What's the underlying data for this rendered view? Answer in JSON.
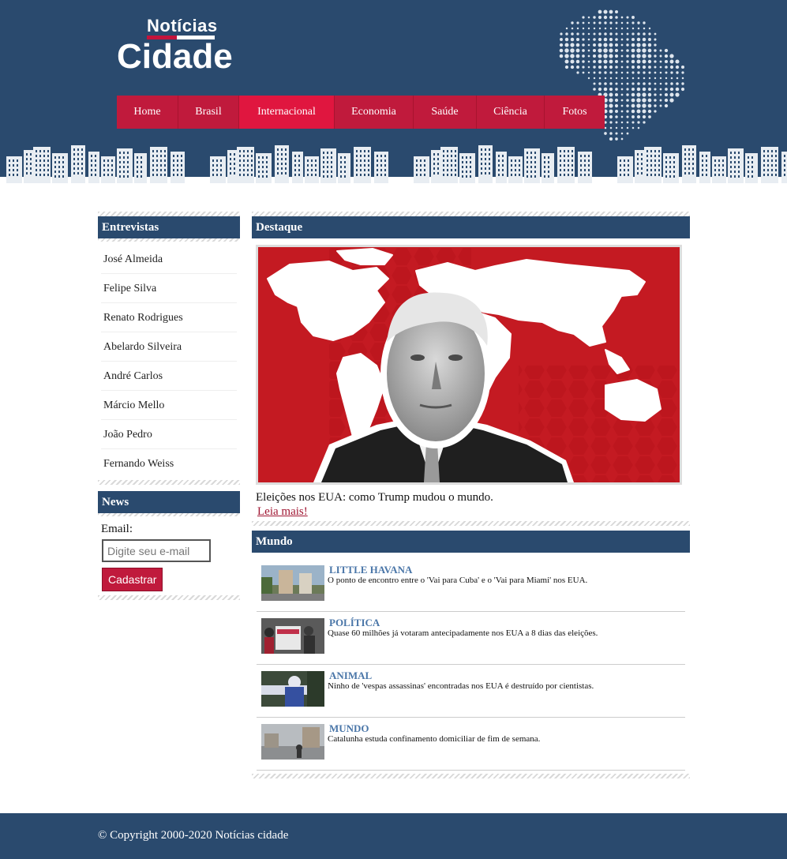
{
  "header": {
    "logo_top": "Notícias",
    "logo_bottom": "Cidade"
  },
  "nav": {
    "items": [
      "Home",
      "Brasil",
      "Internacional",
      "Economia",
      "Saúde",
      "Ciência",
      "Fotos"
    ],
    "active": "Internacional"
  },
  "sidebar": {
    "interviews_title": "Entrevistas",
    "interviews": [
      "José Almeida",
      "Felipe Silva",
      "Renato Rodrigues",
      "Abelardo Silveira",
      "André Carlos",
      "Márcio Mello",
      "João Pedro",
      "Fernando Weiss"
    ],
    "news_title": "News",
    "email_label": "Email:",
    "email_placeholder": "Digite seu e-mail",
    "subscribe_label": "Cadastrar"
  },
  "featured": {
    "title": "Destaque",
    "caption": "Eleições nos EUA: como Trump mudou o mundo.",
    "link": "Leia mais!"
  },
  "world": {
    "title": "Mundo",
    "items": [
      {
        "category": "LITTLE HAVANA",
        "text": "O ponto de encontro entre o 'Vai para Cuba' e o 'Vai para Miami' nos EUA."
      },
      {
        "category": "POLÍTICA",
        "text": "Quase 60 milhões já votaram antecipadamente nos EUA a 8 dias das eleições."
      },
      {
        "category": "ANIMAL",
        "text": "Ninho de 'vespas assassinas' encontradas nos EUA é destruído por cientistas."
      },
      {
        "category": "MUNDO",
        "text": "Catalunha estuda confinamento domiciliar de fim de semana."
      }
    ]
  },
  "footer": {
    "copyright": "© Copyright 2000-2020 Notícias cidade"
  },
  "colors": {
    "primary_blue": "#2a4a6e",
    "accent_red": "#c01a3c",
    "category_blue": "#4a76a8"
  }
}
